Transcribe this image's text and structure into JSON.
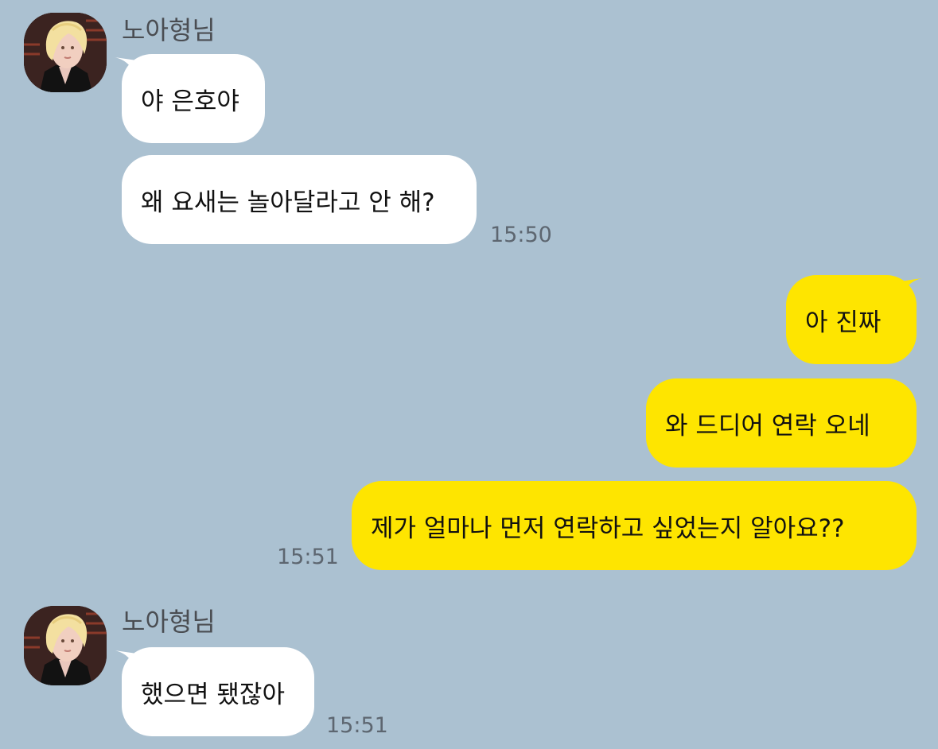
{
  "colors": {
    "background": "#abc1d1",
    "incoming_bubble": "#ffffff",
    "outgoing_bubble": "#fee500",
    "timestamp": "#5d6670",
    "sender_name": "#4a4d52"
  },
  "chat": {
    "groups": [
      {
        "sender": "노아형님",
        "avatar_icon": "profile-photo-icon",
        "messages": [
          "야 은호야",
          "왜 요새는 놀아달라고 안 해?"
        ],
        "time": "15:50"
      },
      {
        "sender": "me",
        "messages": [
          "아 진짜",
          "와 드디어 연락 오네",
          "제가 얼마나 먼저 연락하고 싶었는지 알아요??"
        ],
        "time": "15:51"
      },
      {
        "sender": "노아형님",
        "avatar_icon": "profile-photo-icon",
        "messages": [
          "했으면 됐잖아"
        ],
        "time": "15:51"
      }
    ]
  }
}
